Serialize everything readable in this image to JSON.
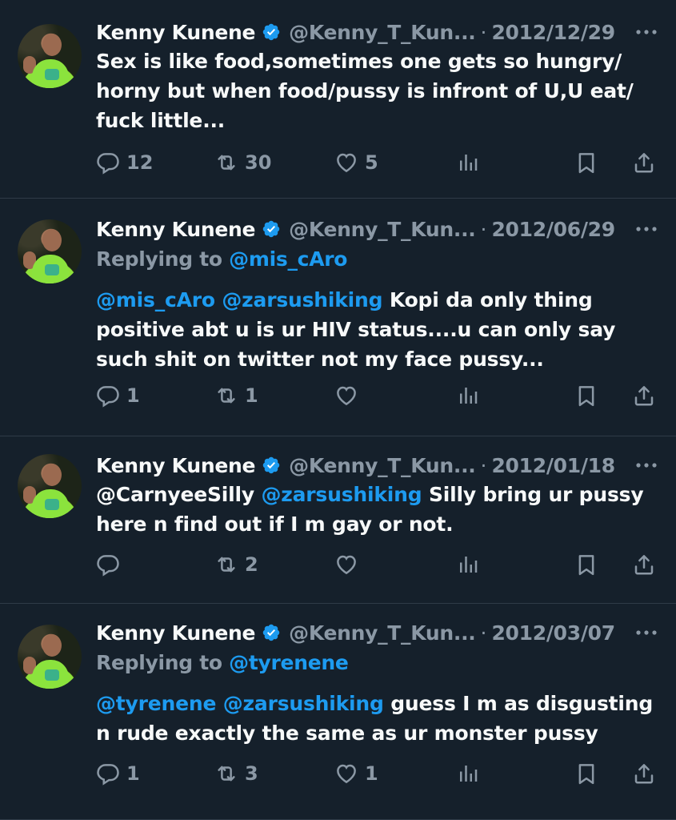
{
  "tweets": [
    {
      "name": "Kenny Kunene",
      "handle": "@Kenny_T_Kun...",
      "dot": "·",
      "date": "2012/12/29",
      "replying_label": "",
      "replying_to": "",
      "body_mentions": "",
      "body_text": "Sex is like food,sometimes one gets so hungry/ horny but when food/pussy is infront of U,U eat/ fuck little...",
      "replies": "12",
      "retweets": "30",
      "likes": "5"
    },
    {
      "name": "Kenny Kunene",
      "handle": "@Kenny_T_Kun...",
      "dot": "·",
      "date": "2012/06/29",
      "replying_label": "Replying to ",
      "replying_to": "@mis_cAro",
      "body_mentions": "@mis_cAro @zarsushiking",
      "body_text": " Kopi da only thing positive abt u is ur HIV status....u can only say such shit on twitter not my face pussy...",
      "replies": "1",
      "retweets": "1",
      "likes": ""
    },
    {
      "name": "Kenny Kunene",
      "handle": "@Kenny_T_Kun...",
      "dot": "·",
      "date": "2012/01/18",
      "replying_label": "",
      "replying_to": "",
      "body_plain_prefix": "@CarnyeeSilly ",
      "body_mentions": "@zarsushiking",
      "body_text": " Silly bring ur pussy here n find out if I m gay or not.",
      "replies": "",
      "retweets": "2",
      "likes": ""
    },
    {
      "name": "Kenny Kunene",
      "handle": "@Kenny_T_Kun...",
      "dot": "·",
      "date": "2012/03/07",
      "replying_label": "Replying to ",
      "replying_to": "@tyrenene",
      "body_mentions": "@tyrenene @zarsushiking",
      "body_text": " guess I m as disgusting n rude exactly the same as ur monster pussy",
      "replies": "1",
      "retweets": "3",
      "likes": "1"
    }
  ],
  "colors": {
    "background": "#15202b",
    "text": "#f7f9f9",
    "muted": "#8b98a5",
    "accent": "#1d9bf0",
    "divider": "#2f3b47"
  },
  "icons": [
    "verified-badge-icon",
    "more-icon",
    "reply-icon",
    "retweet-icon",
    "like-icon",
    "views-icon",
    "bookmark-icon",
    "share-icon"
  ]
}
